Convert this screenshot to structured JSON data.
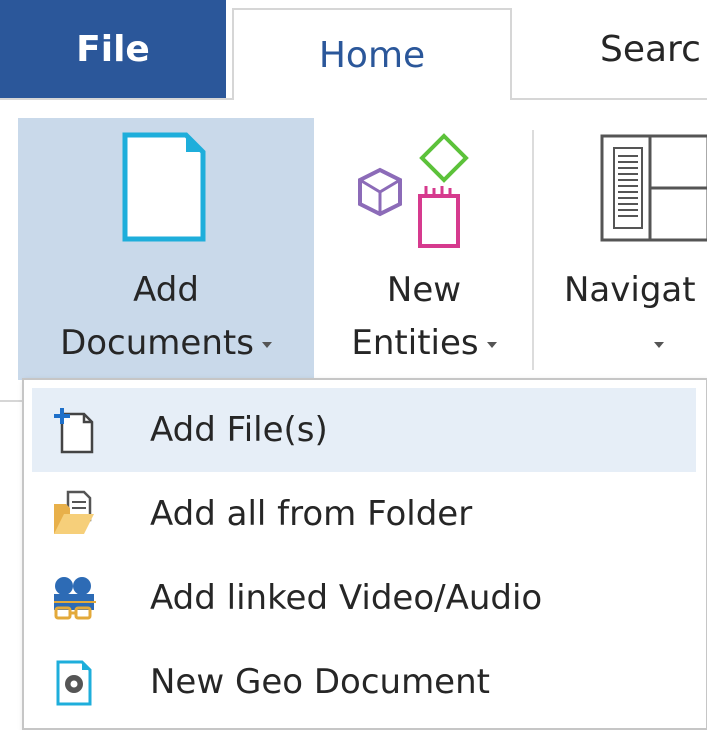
{
  "tabs": {
    "file": "File",
    "home": "Home",
    "search": "Searc"
  },
  "ribbon": {
    "add_documents": {
      "line1": "Add",
      "line2": "Documents",
      "icon": "document-icon"
    },
    "new_entities": {
      "line1": "New",
      "line2": "Entities",
      "icon": "entities-icon"
    },
    "navigation": {
      "line1": "Navigat",
      "icon": "navigation-pane-icon"
    }
  },
  "menu": {
    "items": [
      {
        "label": "Add File(s)",
        "icon": "add-file-icon",
        "highlighted": true
      },
      {
        "label": "Add all from Folder",
        "icon": "folder-icon",
        "highlighted": false
      },
      {
        "label": "Add linked Video/Audio",
        "icon": "video-camera-icon",
        "highlighted": false
      },
      {
        "label": "New Geo Document",
        "icon": "geo-document-icon",
        "highlighted": false
      }
    ]
  },
  "colors": {
    "file_tab_bg": "#2b579a",
    "accent_text": "#2b579a",
    "ribbon_pressed_bg": "#c9d9ea",
    "menu_hover_bg": "#e6eef7",
    "document_icon": "#1eaedb",
    "entity_diamond": "#5cc23a",
    "entity_cube": "#8c6bb8",
    "entity_box": "#d63a8e"
  }
}
